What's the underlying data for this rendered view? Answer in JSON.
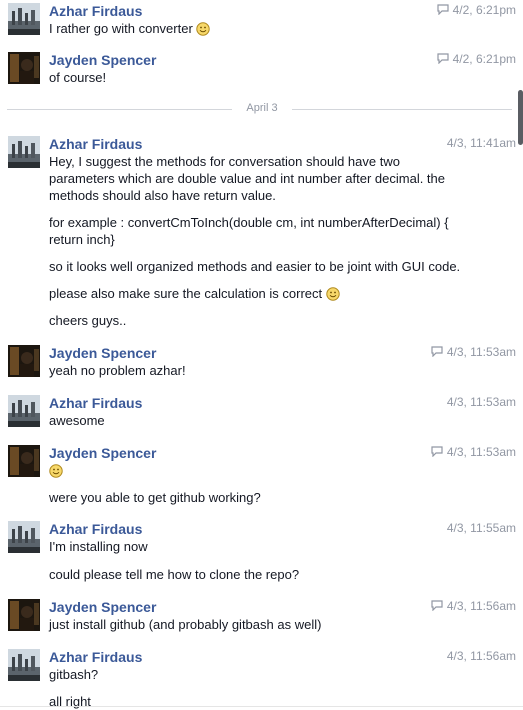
{
  "divider": {
    "label": "April 3"
  },
  "colors": {
    "name": "#3b5998",
    "text": "#141823",
    "meta": "#9197a3"
  },
  "messages": [
    {
      "sender": "Azhar Firdaus",
      "time": "4/2, 6:21pm",
      "icon": "sent-check-icon",
      "lines": [
        "I rather go with converter"
      ],
      "emoji_after": [
        "smile-emoji"
      ]
    },
    {
      "sender": "Jayden Spencer",
      "time": "4/2, 6:21pm",
      "icon": "sent-check-icon",
      "lines": [
        "of course!"
      ]
    },
    {
      "sender": "Azhar Firdaus",
      "time": "4/3, 11:41am",
      "lines": [
        "Hey, I suggest the methods for conversation should have two parameters which are double value and int number after decimal. the methods should also have return value.",
        "for example : convertCmToInch(double cm, int numberAfterDecimal) { return inch}",
        "so it looks well organized methods and easier to be joint with GUI code.",
        "please also make sure the calculation is correct",
        "cheers guys.."
      ]
    },
    {
      "sender": "Jayden Spencer",
      "time": "4/3, 11:53am",
      "icon": "sent-check-icon",
      "lines": [
        "yeah no problem azhar!"
      ]
    },
    {
      "sender": "Azhar Firdaus",
      "time": "4/3, 11:53am",
      "lines": [
        "awesome"
      ]
    },
    {
      "sender": "Jayden Spencer",
      "time": "4/3, 11:53am",
      "icon": "sent-check-icon",
      "lines": [
        "were you able to get github working?"
      ]
    },
    {
      "sender": "Azhar Firdaus",
      "time": "4/3, 11:55am",
      "lines": [
        "I'm installing now",
        "could please tell me how to clone the repo?"
      ]
    },
    {
      "sender": "Jayden Spencer",
      "time": "4/3, 11:56am",
      "icon": "sent-check-icon",
      "lines": [
        "just install github (and probably gitbash as well)"
      ]
    },
    {
      "sender": "Azhar Firdaus",
      "time": "4/3, 11:56am",
      "lines": [
        "gitbash?",
        "all right"
      ]
    }
  ]
}
